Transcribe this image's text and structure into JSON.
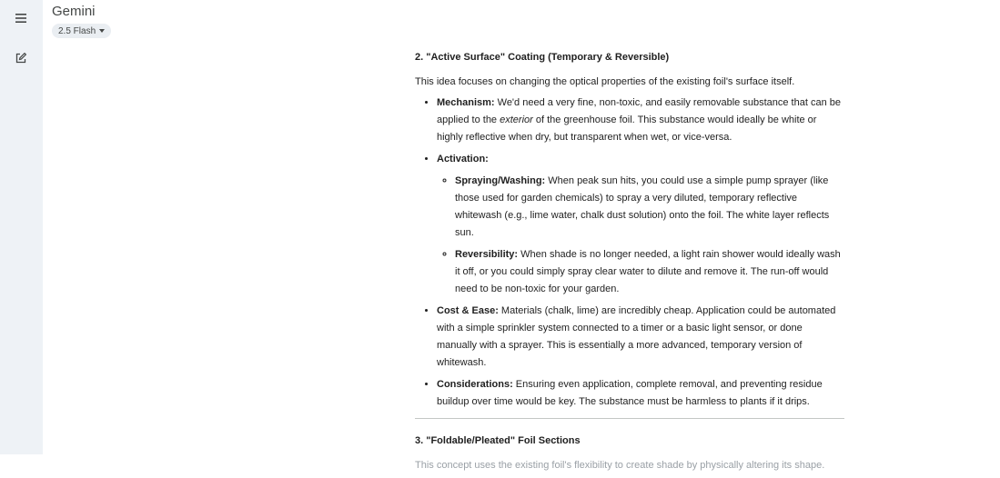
{
  "app": {
    "title": "Gemini",
    "model": "2.5 Flash"
  },
  "section2": {
    "heading": "2. \"Active Surface\" Coating (Temporary & Reversible)",
    "intro": "This idea focuses on changing the optical properties of the existing foil's surface itself.",
    "mechanism": {
      "label": "Mechanism:",
      "text_a": " We'd need a very fine, non-toxic, and easily removable substance that can be applied to the ",
      "text_em": "exterior",
      "text_b": " of the greenhouse foil. This substance would ideally be white or highly reflective when dry, but transparent when wet, or vice-versa."
    },
    "activation": {
      "label": "Activation:",
      "spraying_label": "Spraying/Washing:",
      "spraying_text": " When peak sun hits, you could use a simple pump sprayer (like those used for garden chemicals) to spray a very diluted, temporary reflective whitewash (e.g., lime water, chalk dust solution) onto the foil. The white layer reflects sun.",
      "reversibility_label": "Reversibility:",
      "reversibility_text": " When shade is no longer needed, a light rain shower would ideally wash it off, or you could simply spray clear water to dilute and remove it. The run-off would need to be non-toxic for your garden."
    },
    "cost": {
      "label": "Cost & Ease:",
      "text": " Materials (chalk, lime) are incredibly cheap. Application could be automated with a simple sprinkler system connected to a timer or a basic light sensor, or done manually with a sprayer. This is essentially a more advanced, temporary version of whitewash."
    },
    "considerations": {
      "label": "Considerations:",
      "text": " Ensuring even application, complete removal, and preventing residue buildup over time would be key. The substance must be harmless to plants if it drips."
    }
  },
  "section3": {
    "heading": "3. \"Foldable/Pleated\" Foil Sections",
    "intro": "This concept uses the existing foil's flexibility to create shade by physically altering its shape."
  }
}
